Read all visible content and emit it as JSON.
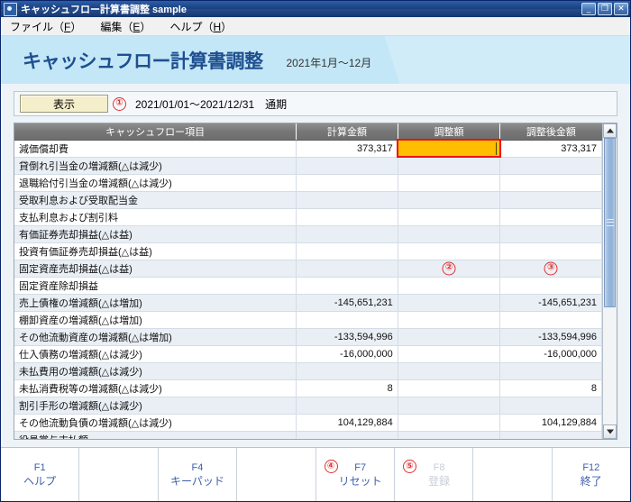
{
  "window": {
    "title": "キャッシュフロー計算書調整 sample",
    "icon": "app-icon",
    "controls": {
      "minimize": "_",
      "maximize": "❐",
      "close": "✕"
    }
  },
  "menu": [
    {
      "label": "ファイル",
      "accel": "F"
    },
    {
      "label": "編集",
      "accel": "E"
    },
    {
      "label": "ヘルプ",
      "accel": "H"
    }
  ],
  "header": {
    "title": "キャッシュフロー計算書調整",
    "period": "2021年1月～12月",
    "band_color": "#c3e7f7",
    "title_color": "#1f4f8f"
  },
  "toolbar": {
    "display_button": "表示",
    "marker": "①",
    "date_range": "2021/01/01～2021/12/31",
    "term": "通期"
  },
  "table": {
    "columns": [
      "キャッシュフロー項目",
      "計算金額",
      "調整額",
      "調整後金額"
    ],
    "active_cell_color": "#ffbf00",
    "active_cell_border_color": "#ee1111",
    "column_markers": {
      "adjust": "②",
      "after": "③"
    },
    "rows": [
      {
        "item": "減価償却費",
        "calc": "373,317",
        "adjust": "",
        "after": "373,317",
        "active": true
      },
      {
        "item": "貸倒れ引当金の増減額(△は減少)",
        "calc": "",
        "adjust": "",
        "after": ""
      },
      {
        "item": "退職給付引当金の増減額(△は減少)",
        "calc": "",
        "adjust": "",
        "after": ""
      },
      {
        "item": "受取利息および受取配当金",
        "calc": "",
        "adjust": "",
        "after": ""
      },
      {
        "item": "支払利息および割引料",
        "calc": "",
        "adjust": "",
        "after": ""
      },
      {
        "item": "有価証券売却損益(△は益)",
        "calc": "",
        "adjust": "",
        "after": ""
      },
      {
        "item": "投資有価証券売却損益(△は益)",
        "calc": "",
        "adjust": "",
        "after": ""
      },
      {
        "item": "固定資産売却損益(△は益)",
        "calc": "",
        "adjust": "",
        "after": "",
        "marker_adjust": "②",
        "marker_after": "③"
      },
      {
        "item": "固定資産除却損益",
        "calc": "",
        "adjust": "",
        "after": ""
      },
      {
        "item": "売上債権の増減額(△は増加)",
        "calc": "-145,651,231",
        "adjust": "",
        "after": "-145,651,231"
      },
      {
        "item": "棚卸資産の増減額(△は増加)",
        "calc": "",
        "adjust": "",
        "after": ""
      },
      {
        "item": "その他流動資産の増減額(△は増加)",
        "calc": "-133,594,996",
        "adjust": "",
        "after": "-133,594,996"
      },
      {
        "item": "仕入債務の増減額(△は減少)",
        "calc": "-16,000,000",
        "adjust": "",
        "after": "-16,000,000"
      },
      {
        "item": "未払費用の増減額(△は減少)",
        "calc": "",
        "adjust": "",
        "after": ""
      },
      {
        "item": "未払消費税等の増減額(△は減少)",
        "calc": "8",
        "adjust": "",
        "after": "8"
      },
      {
        "item": "割引手形の増減額(△は減少)",
        "calc": "",
        "adjust": "",
        "after": ""
      },
      {
        "item": "その他流動負債の増減額(△は減少)",
        "calc": "104,129,884",
        "adjust": "",
        "after": "104,129,884"
      },
      {
        "item": "役員賞与支払額",
        "calc": "",
        "adjust": "",
        "after": ""
      }
    ]
  },
  "scrollbar": {
    "up_arrow": "▲",
    "down_arrow": "▼",
    "thumb_position_percent": 0,
    "thumb_size_percent": 59
  },
  "function_keys": [
    {
      "code": "F1",
      "label": "ヘルプ",
      "state": "enabled",
      "marker": ""
    },
    {
      "code": "",
      "label": "",
      "state": "empty",
      "marker": ""
    },
    {
      "code": "F4",
      "label": "キーパッド",
      "state": "enabled",
      "marker": ""
    },
    {
      "code": "",
      "label": "",
      "state": "empty",
      "marker": ""
    },
    {
      "code": "F7",
      "label": "リセット",
      "state": "enabled",
      "marker": "④"
    },
    {
      "code": "F8",
      "label": "登録",
      "state": "disabled",
      "marker": "⑤"
    },
    {
      "code": "",
      "label": "",
      "state": "empty",
      "marker": ""
    },
    {
      "code": "F12",
      "label": "終了",
      "state": "enabled",
      "marker": ""
    }
  ]
}
